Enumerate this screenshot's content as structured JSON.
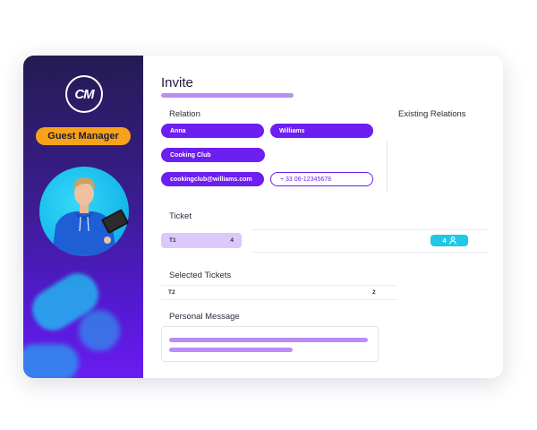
{
  "sidebar": {
    "logo_text": "CM",
    "role": "Guest Manager",
    "accent_color": "#6d1ef0",
    "badge_color": "#f7a21b"
  },
  "main": {
    "title": "Invite",
    "relation": {
      "label": "Relation",
      "first_name": "Anna",
      "last_name": "Williams",
      "company": "Cooking Club",
      "email": "cookingclub@williams.com",
      "phone": "+ 33 06-12345678"
    },
    "existing_relations": {
      "label": "Existing Relations"
    },
    "ticket": {
      "label": "Ticket",
      "selected_type": "T1",
      "selected_quantity": "4",
      "guest_count": "4",
      "guest_icon": "person-icon"
    },
    "selected_tickets": {
      "label": "Selected Tickets",
      "rows": [
        {
          "type": "T2",
          "quantity": "2"
        }
      ]
    },
    "personal_message": {
      "label": "Personal Message"
    }
  }
}
